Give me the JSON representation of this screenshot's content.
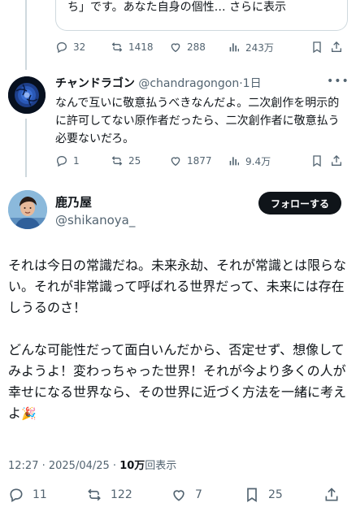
{
  "quoted": {
    "text": "ち」です。あなた自身の個性… ",
    "more": "さらに表示"
  },
  "top_actions": {
    "replies": "32",
    "reposts": "1418",
    "likes": "288",
    "views": "243万"
  },
  "reply": {
    "name": "チャンドラゴン",
    "handle": "@chandragongon",
    "time": "·1日",
    "body": "なんで互いに敬意払うべきなんだよ。二次創作を明示的に許可してない原作者だったら、二次創作者に敬意払う必要ないだろ。",
    "replies": "1",
    "reposts": "25",
    "likes": "1877",
    "views": "9.4万"
  },
  "main": {
    "name": "鹿乃屋",
    "handle": "@shikanoya_",
    "follow_label": "フォローする",
    "para1": "それは今日の常識だね。未来永劫、それが常識とは限らない。それが非常識って呼ばれる世界だって、未来には存在しうるのさ！",
    "para2": "どんな可能性だって面白いんだから、否定せず、想像してみようよ！変わっちゃった世界！それが今より多くの人が幸せになる世界なら、その世界に近づく方法を一緒に考えよ",
    "emoji": "🎉",
    "timestamp": "12:27 · 2025/04/25 · ",
    "views_count": "10万",
    "views_label": "回表示",
    "replies": "11",
    "reposts": "122",
    "likes": "7",
    "bookmarks": "25"
  },
  "icons": [
    "reply-icon",
    "repost-icon",
    "like-icon",
    "views-icon",
    "bookmark-icon",
    "share-icon"
  ],
  "colors": {
    "text": "#0f1419",
    "muted": "#536471",
    "border": "#cfd9de",
    "button": "#0f1419"
  }
}
